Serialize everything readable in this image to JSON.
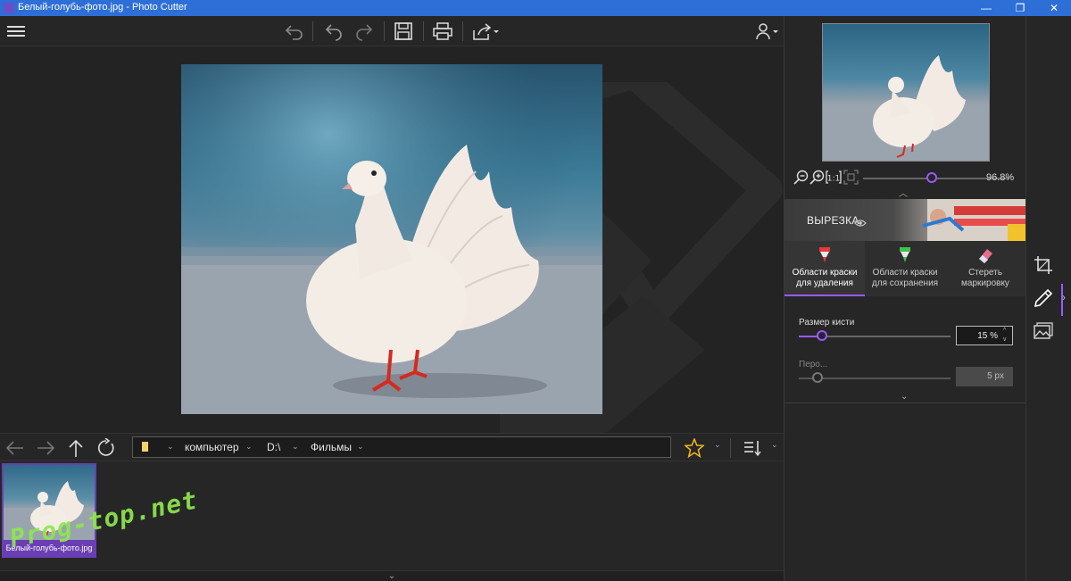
{
  "window": {
    "title": "Белый-голубь-фото.jpg - Photo Cutter",
    "minimize": "—",
    "maximize": "❐",
    "close": "✕"
  },
  "toolbar": {
    "icons": [
      "menu-icon",
      "undo-all-icon",
      "undo-icon",
      "redo-icon",
      "save-icon",
      "print-icon",
      "share-icon",
      "user-icon"
    ]
  },
  "navigation": {
    "breadcrumbs": [
      "компьютер",
      "D:\\",
      "Фильмы"
    ]
  },
  "filmstrip": {
    "items": [
      {
        "label": "Белый-голубь-фото.jpg",
        "selected": true
      }
    ]
  },
  "watermark": "Prog-top.net",
  "preview": {
    "zoom_value": "96.8%",
    "zoom_fraction": 0.47
  },
  "cut_section": {
    "title": "ВЫРЕЗКА"
  },
  "modes": [
    {
      "label_line1": "Области краски",
      "label_line2": "для удаления",
      "icon": "red-marker-icon",
      "active": true
    },
    {
      "label_line1": "Области краски",
      "label_line2": "для сохранения",
      "icon": "green-marker-icon",
      "active": false
    },
    {
      "label_line1": "Стереть маркировку",
      "label_line2": "",
      "icon": "eraser-icon",
      "active": false
    }
  ],
  "brush": {
    "label": "Размер кисти",
    "value": "15 %",
    "level": 0.15
  },
  "feather": {
    "label": "Перо...",
    "value": "5 px",
    "level": 0.05
  },
  "colors": {
    "accent": "#9b59ff",
    "titlebar": "#2d6fd6",
    "watermark": "#8ee84e"
  }
}
